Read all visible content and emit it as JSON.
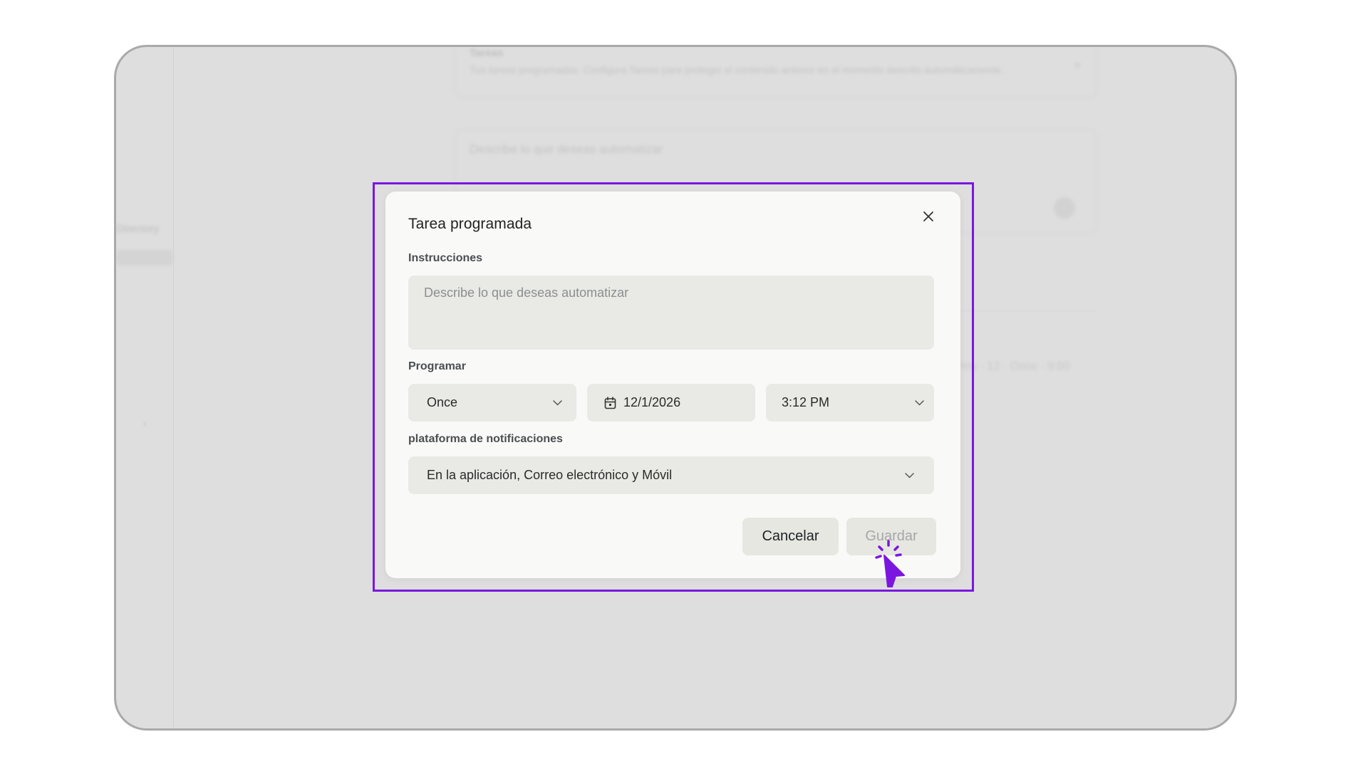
{
  "background": {
    "sidebar_text": "Directory",
    "card_title": "Tareas",
    "card_description": "Tus tareas programadas. Configura Tareas para proteger el contenido anterior en el momento descrito automáticamente.",
    "input_placeholder": "Describe lo que deseas automatizar",
    "right_text": "Hoy · 12 · Once · 9:00"
  },
  "modal": {
    "title": "Tarea programada",
    "close_icon": "close-icon",
    "instructions_label": "Instrucciones",
    "instructions_placeholder": "Describe lo que deseas automatizar",
    "instructions_value": "",
    "schedule_label": "Programar",
    "frequency_value": "Once",
    "date_value": "12/1/2026",
    "date_icon": "calendar-icon",
    "time_value": "3:12 PM",
    "notifications_label": "plataforma de notificaciones",
    "notifications_value": "En la aplicación, Correo electrónico y Móvil",
    "cancel_label": "Cancelar",
    "save_label": "Guardar"
  },
  "colors": {
    "highlight": "#7b16e0",
    "cursor": "#7b16e0",
    "overlay": "#dedede",
    "modal_bg": "#f9f9f7",
    "field_bg": "#e9e9e5"
  }
}
